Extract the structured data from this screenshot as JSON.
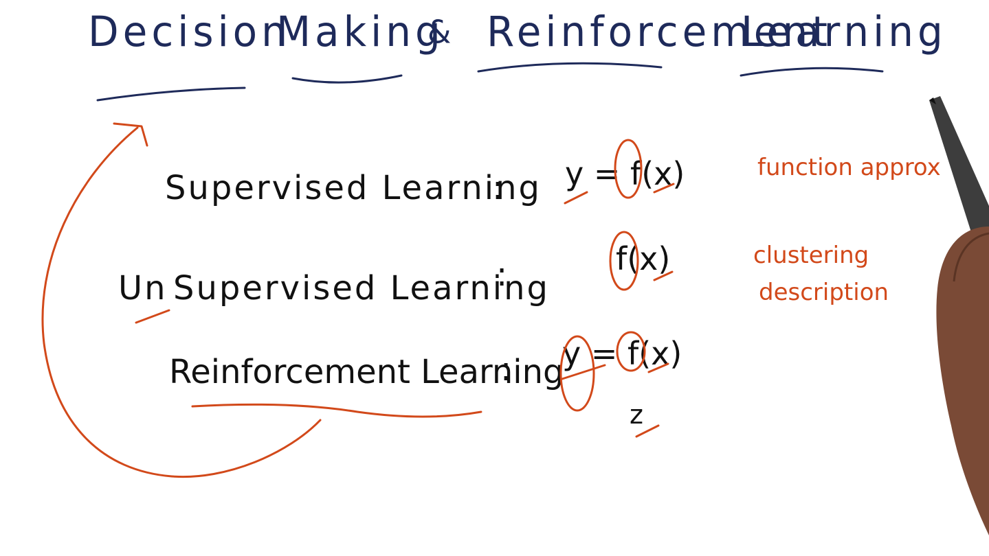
{
  "title": {
    "words": [
      "Decision",
      "Making",
      "&",
      "Reinforcement",
      "Learning"
    ]
  },
  "rows": [
    {
      "label": "Supervised Learning",
      "colon": ":",
      "formula": "y = f(x)",
      "note": "function approx"
    },
    {
      "label_prefix": "Un",
      "label": "Supervised Learning",
      "colon": ":",
      "formula": "f(x)",
      "note_lines": [
        "clustering",
        "description"
      ]
    },
    {
      "label": "Reinforcement Learning",
      "colon": ":",
      "formula": "y = f(x)",
      "extra": "z"
    }
  ],
  "colors": {
    "title_ink": "#1e2a5a",
    "body_ink": "#111111",
    "annotation_ink": "#d2491a"
  }
}
